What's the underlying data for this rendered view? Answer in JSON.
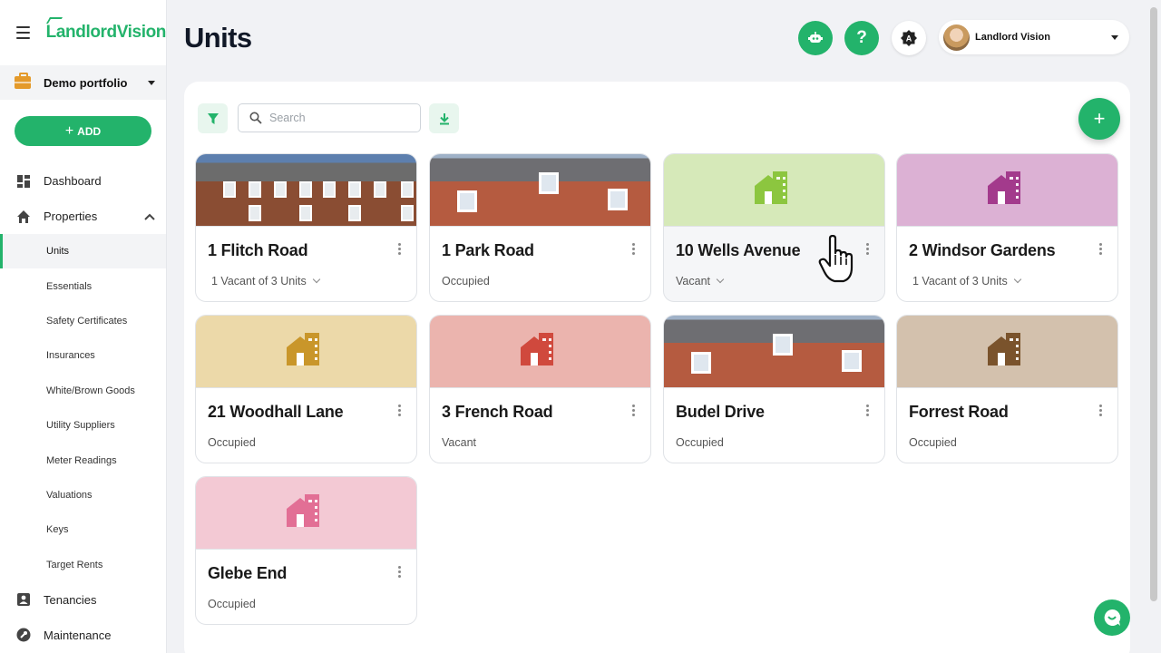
{
  "app": {
    "logo": "LandlordVision"
  },
  "portfolio": {
    "label": "Demo portfolio"
  },
  "add_button": {
    "label": "ADD"
  },
  "nav": {
    "dashboard": "Dashboard",
    "properties": "Properties",
    "sub_items": [
      "Units",
      "Essentials",
      "Safety Certificates",
      "Insurances",
      "White/Brown Goods",
      "Utility Suppliers",
      "Meter Readings",
      "Valuations",
      "Keys",
      "Target Rents"
    ],
    "tenancies": "Tenancies",
    "maintenance": "Maintenance"
  },
  "header": {
    "title": "Units",
    "user_name": "Landlord Vision"
  },
  "toolbar": {
    "search_placeholder": "Search"
  },
  "units": [
    {
      "name": "1 Flitch Road",
      "status": "1 Vacant of 3 Units",
      "expandable": true,
      "image": "photo-flats"
    },
    {
      "name": "1 Park Road",
      "status": "Occupied",
      "expandable": false,
      "image": "photo-brick"
    },
    {
      "name": "10 Wells Avenue",
      "status": "Vacant",
      "expandable": true,
      "icon_color": "#8cc63f",
      "bg": "#d6e9b9"
    },
    {
      "name": "2 Windsor Gardens",
      "status": "1 Vacant of 3 Units",
      "expandable": true,
      "icon_color": "#a33a8c",
      "bg": "#dcb1d4"
    },
    {
      "name": "21 Woodhall Lane",
      "status": "Occupied",
      "expandable": false,
      "icon_color": "#c9962a",
      "bg": "#ecd9a9"
    },
    {
      "name": "3 French Road",
      "status": "Vacant",
      "expandable": false,
      "icon_color": "#d0493d",
      "bg": "#ebb4ae"
    },
    {
      "name": "Budel Drive",
      "status": "Occupied",
      "expandable": false,
      "image": "photo-brick"
    },
    {
      "name": "Forrest Road",
      "status": "Occupied",
      "expandable": false,
      "icon_color": "#7a532c",
      "bg": "#d3c1ad"
    },
    {
      "name": "Glebe End",
      "status": "Occupied",
      "expandable": false,
      "icon_color": "#e26f95",
      "bg": "#f3c9d4"
    }
  ],
  "colors": {
    "brand": "#23b36b",
    "accent_orange": "#e49a2b"
  }
}
